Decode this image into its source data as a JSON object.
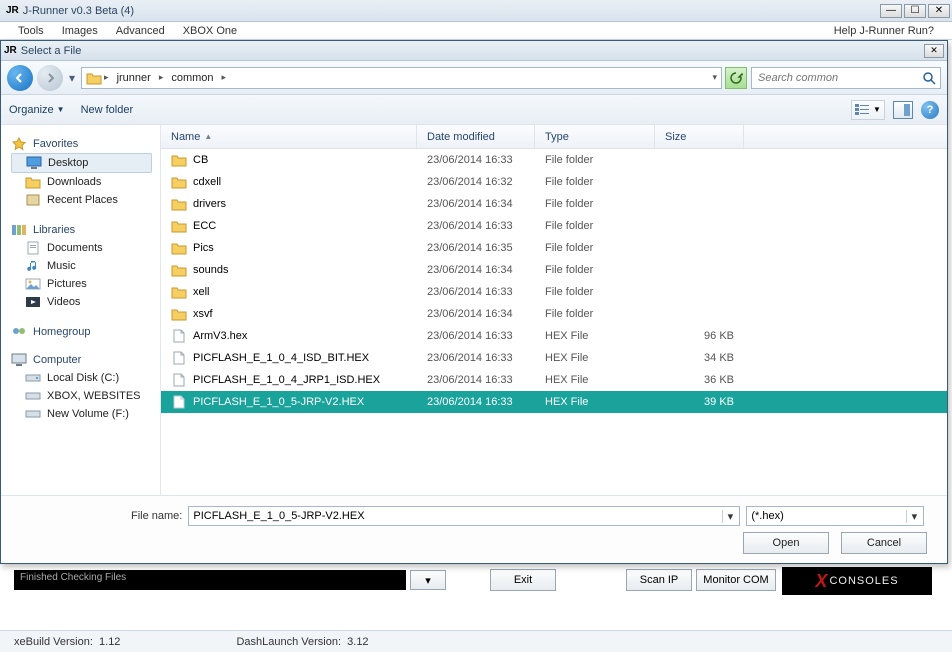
{
  "main_window": {
    "logo_text": "JR",
    "title": "J-Runner v0.3 Beta (4)",
    "menu": {
      "tools": "Tools",
      "images": "Images",
      "advanced": "Advanced",
      "xbox_one": "XBOX One",
      "help": "Help J-Runner Run?"
    }
  },
  "dialog": {
    "logo_text": "JR",
    "title": "Select a File",
    "breadcrumb": {
      "seg1": "jrunner",
      "seg2": "common"
    },
    "search_placeholder": "Search common",
    "toolbar": {
      "organize": "Organize",
      "new_folder": "New folder"
    },
    "columns": {
      "name": "Name",
      "date": "Date modified",
      "type": "Type",
      "size": "Size"
    },
    "filename_label": "File name:",
    "filename_value": "PICFLASH_E_1_0_5-JRP-V2.HEX",
    "filter_value": "(*.hex)",
    "open_label": "Open",
    "cancel_label": "Cancel"
  },
  "sidebar": {
    "favorites": "Favorites",
    "desktop": "Desktop",
    "downloads": "Downloads",
    "recent": "Recent Places",
    "libraries": "Libraries",
    "documents": "Documents",
    "music": "Music",
    "pictures": "Pictures",
    "videos": "Videos",
    "homegroup": "Homegroup",
    "computer": "Computer",
    "local_disk": "Local Disk (C:)",
    "xbox_web": "XBOX, WEBSITES",
    "new_volume": "New Volume (F:)"
  },
  "files": [
    {
      "name": "CB",
      "date": "23/06/2014 16:33",
      "type": "File folder",
      "size": "",
      "kind": "folder",
      "selected": false
    },
    {
      "name": "cdxell",
      "date": "23/06/2014 16:32",
      "type": "File folder",
      "size": "",
      "kind": "folder",
      "selected": false
    },
    {
      "name": "drivers",
      "date": "23/06/2014 16:34",
      "type": "File folder",
      "size": "",
      "kind": "folder",
      "selected": false
    },
    {
      "name": "ECC",
      "date": "23/06/2014 16:33",
      "type": "File folder",
      "size": "",
      "kind": "folder",
      "selected": false
    },
    {
      "name": "Pics",
      "date": "23/06/2014 16:35",
      "type": "File folder",
      "size": "",
      "kind": "folder",
      "selected": false
    },
    {
      "name": "sounds",
      "date": "23/06/2014 16:34",
      "type": "File folder",
      "size": "",
      "kind": "folder",
      "selected": false
    },
    {
      "name": "xell",
      "date": "23/06/2014 16:33",
      "type": "File folder",
      "size": "",
      "kind": "folder",
      "selected": false
    },
    {
      "name": "xsvf",
      "date": "23/06/2014 16:34",
      "type": "File folder",
      "size": "",
      "kind": "folder",
      "selected": false
    },
    {
      "name": "ArmV3.hex",
      "date": "23/06/2014 16:33",
      "type": "HEX File",
      "size": "96 KB",
      "kind": "file",
      "selected": false
    },
    {
      "name": "PICFLASH_E_1_0_4_ISD_BIT.HEX",
      "date": "23/06/2014 16:33",
      "type": "HEX File",
      "size": "34 KB",
      "kind": "file",
      "selected": false
    },
    {
      "name": "PICFLASH_E_1_0_4_JRP1_ISD.HEX",
      "date": "23/06/2014 16:33",
      "type": "HEX File",
      "size": "36 KB",
      "kind": "file",
      "selected": false
    },
    {
      "name": "PICFLASH_E_1_0_5-JRP-V2.HEX",
      "date": "23/06/2014 16:33",
      "type": "HEX File",
      "size": "39 KB",
      "kind": "file",
      "selected": true
    }
  ],
  "background": {
    "console_text": "Finished Checking Files",
    "exit": "Exit",
    "scan_ip": "Scan IP",
    "monitor_com": "Monitor COM",
    "brand": "CONSOLES",
    "xe_label": "xeBuild Version:",
    "xe_value": "1.12",
    "dash_label": "DashLaunch Version:",
    "dash_value": "3.12"
  }
}
